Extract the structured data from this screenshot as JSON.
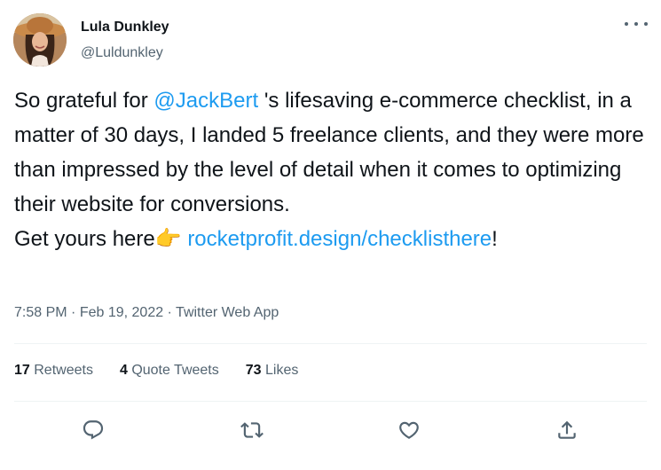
{
  "author": {
    "name": "Lula Dunkley",
    "handle": "@Luldunkley"
  },
  "tweet": {
    "line1_pre": "So grateful for ",
    "mention": "@JackBert",
    "line1_post": " 's lifesaving e-commerce checklist, in a matter of 30 days, I landed 5 freelance clients, and they were more than impressed by the level of detail when it comes to optimizing their website for conversions.",
    "line2_pre": "Get yours here",
    "emoji": "👉",
    "link": "rocketprofit.design/checklisthere",
    "line2_post": "!"
  },
  "meta": {
    "time": "7:58 PM",
    "sep1": " · ",
    "date": "Feb 19, 2022",
    "sep2": " · ",
    "app": "Twitter Web App"
  },
  "stats": {
    "retweets_count": "17",
    "retweets_label": "Retweets",
    "quotes_count": "4",
    "quotes_label": "Quote Tweets",
    "likes_count": "73",
    "likes_label": "Likes"
  },
  "icons": {
    "reply": "reply-icon",
    "retweet": "retweet-icon",
    "like": "like-icon",
    "share": "share-icon",
    "more": "more-icon"
  },
  "colors": {
    "text": "#0f1419",
    "secondary": "#536471",
    "link": "#1d9bf0",
    "divider": "#eff3f4"
  }
}
